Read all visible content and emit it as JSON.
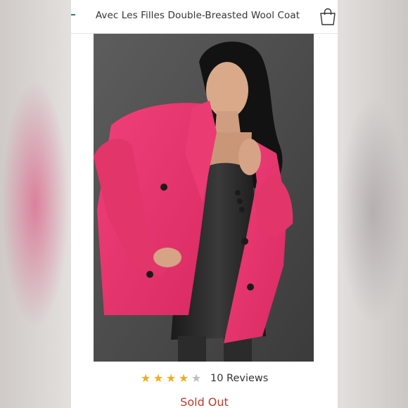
{
  "header": {
    "title": "Avec Les Filles Double-Breasted Wool Coat",
    "cart_icon": "shopping-bag-icon"
  },
  "product": {
    "image_alt": "model-wearing-pink-double-breasted-coat",
    "rating": 4,
    "rating_max": 5,
    "reviews_label": "10 Reviews",
    "status_label": "Sold Out"
  },
  "colors": {
    "coat_pink": "#e8366f",
    "star_filled": "#e9b01e",
    "star_empty": "#bdbdbd",
    "sold_out": "#c0392b"
  }
}
